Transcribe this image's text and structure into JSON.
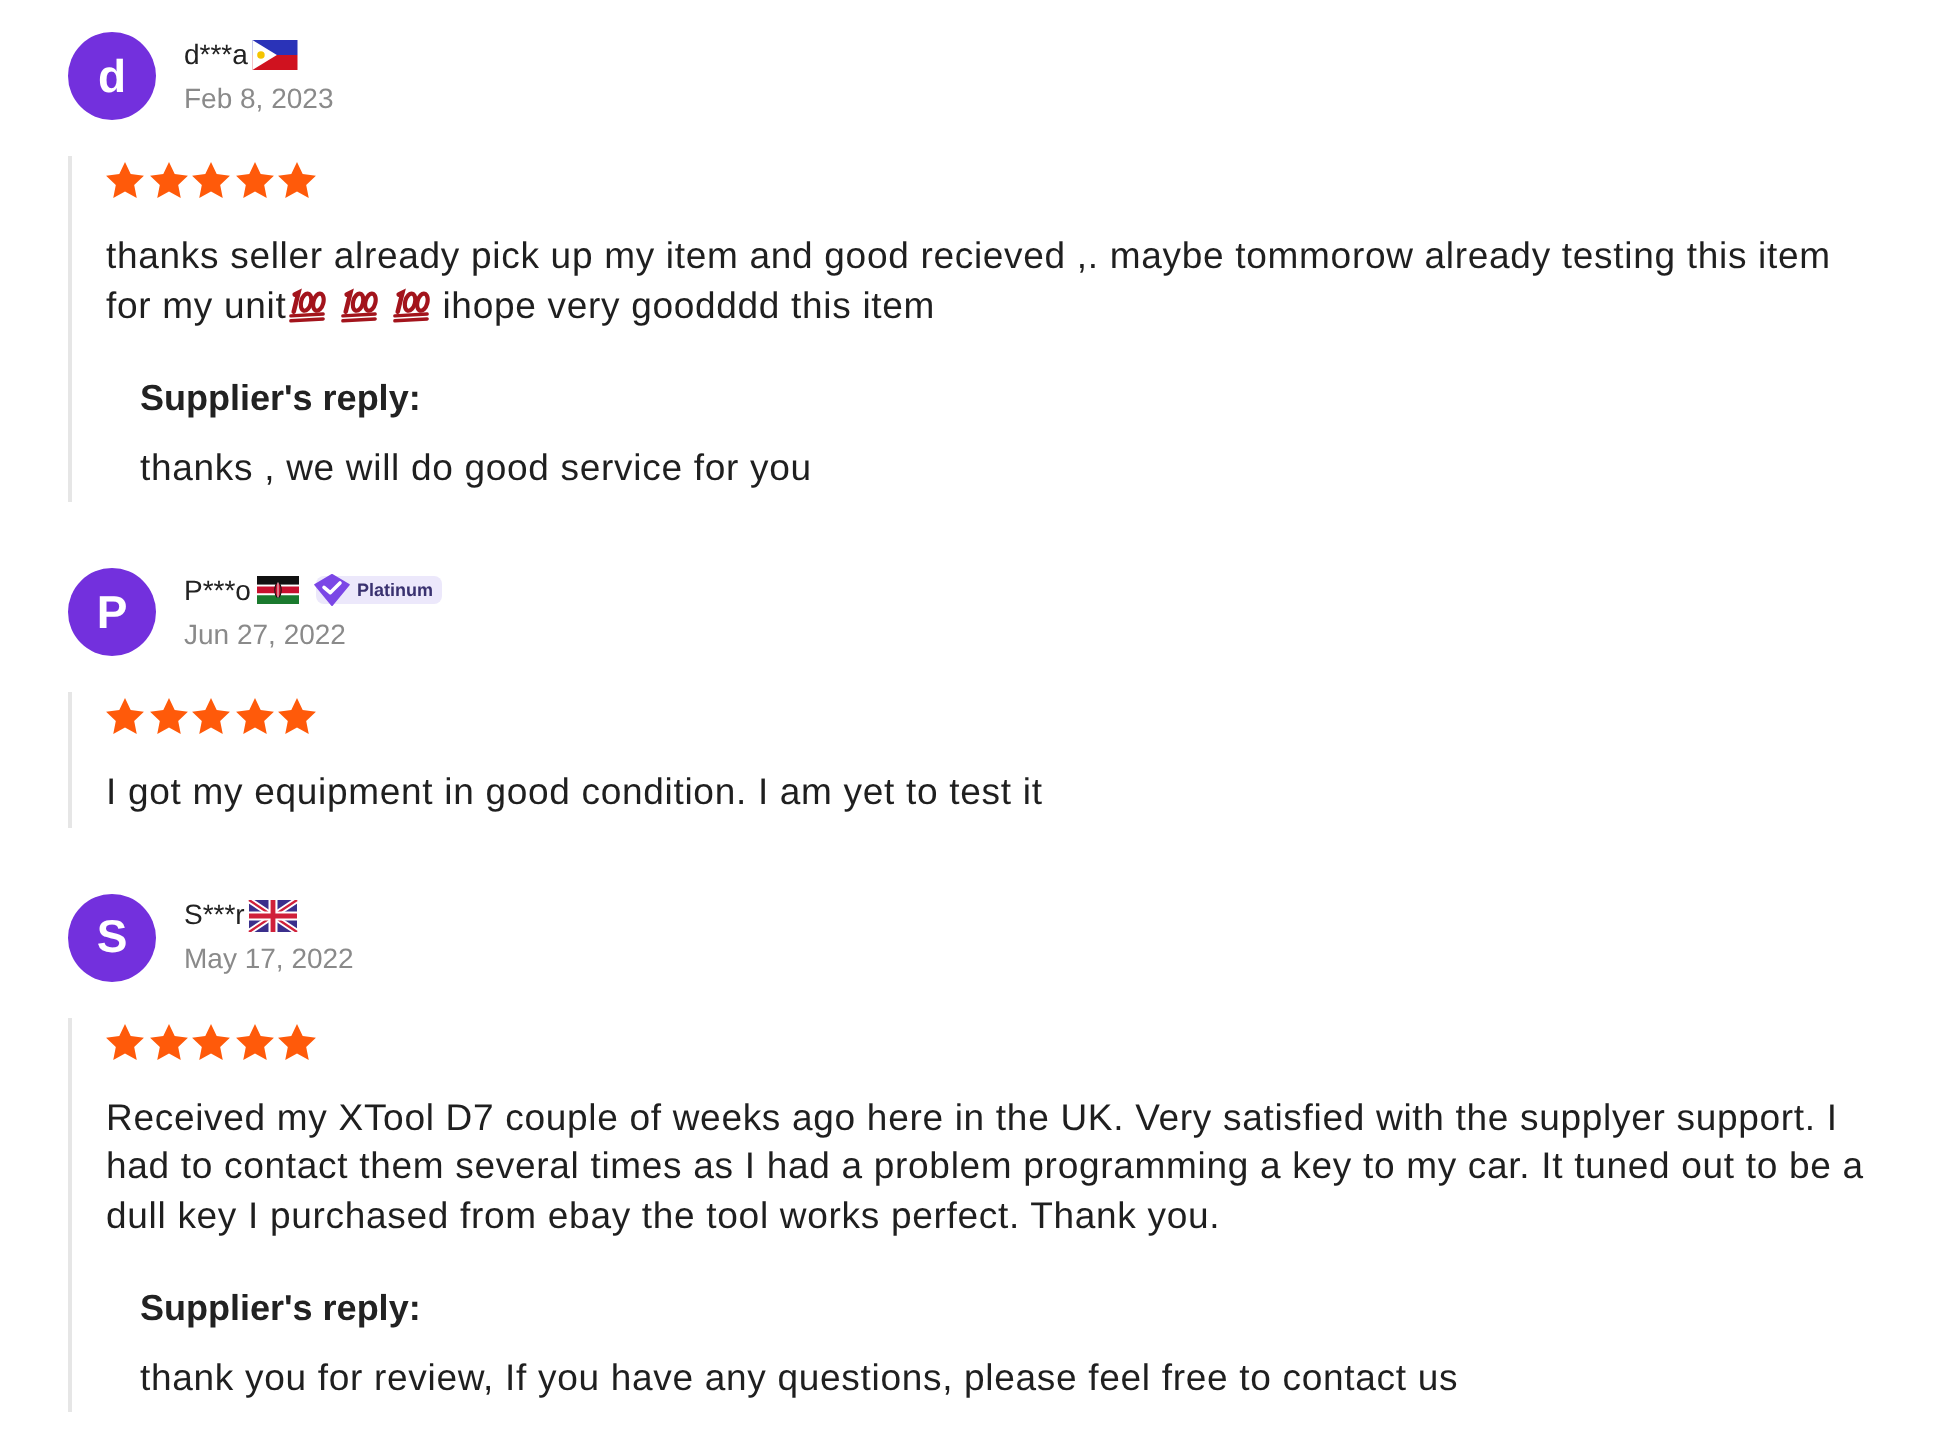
{
  "reviews": [
    {
      "avatar_letter": "d",
      "name": "d***a",
      "flag": {
        "kind": "ph"
      },
      "date": "Feb 8, 2023",
      "stars": 5,
      "body": [
        {
          "kind": "text",
          "text": "thanks seller already pick up my item and good recieved ,. maybe tommorow already testing this item for my unit"
        },
        {
          "kind": "emoji"
        },
        {
          "kind": "emoji"
        },
        {
          "kind": "emoji"
        },
        {
          "kind": "text",
          "text": "ihope very goodddd this item"
        }
      ],
      "reply": {
        "label": "Supplier's reply:",
        "text": "thanks , we will do good service for you"
      }
    },
    {
      "avatar_letter": "P",
      "name": "P***o",
      "flag": {
        "kind": "ke"
      },
      "badge": "Platinum",
      "date": "Jun 27, 2022",
      "stars": 5,
      "body": [
        {
          "kind": "text",
          "text": "I got my equipment in good condition. I am yet to test it"
        }
      ]
    },
    {
      "avatar_letter": "S",
      "name": "S***r",
      "flag": {
        "kind": "gb"
      },
      "date": "May 17, 2022",
      "stars": 5,
      "body": [
        {
          "kind": "text",
          "text": "Received my XTool D7 couple of weeks ago here in the UK. Very satisfied with the supplyer support. I had to contact them several times as I had a problem programming a key to my car. It tuned out to be a dull key I purchased from ebay the tool works perfect. Thank you."
        }
      ],
      "reply": {
        "label": "Supplier's reply:",
        "text": "thank you for review, If you have any questions, please feel free to contact us"
      }
    }
  ]
}
